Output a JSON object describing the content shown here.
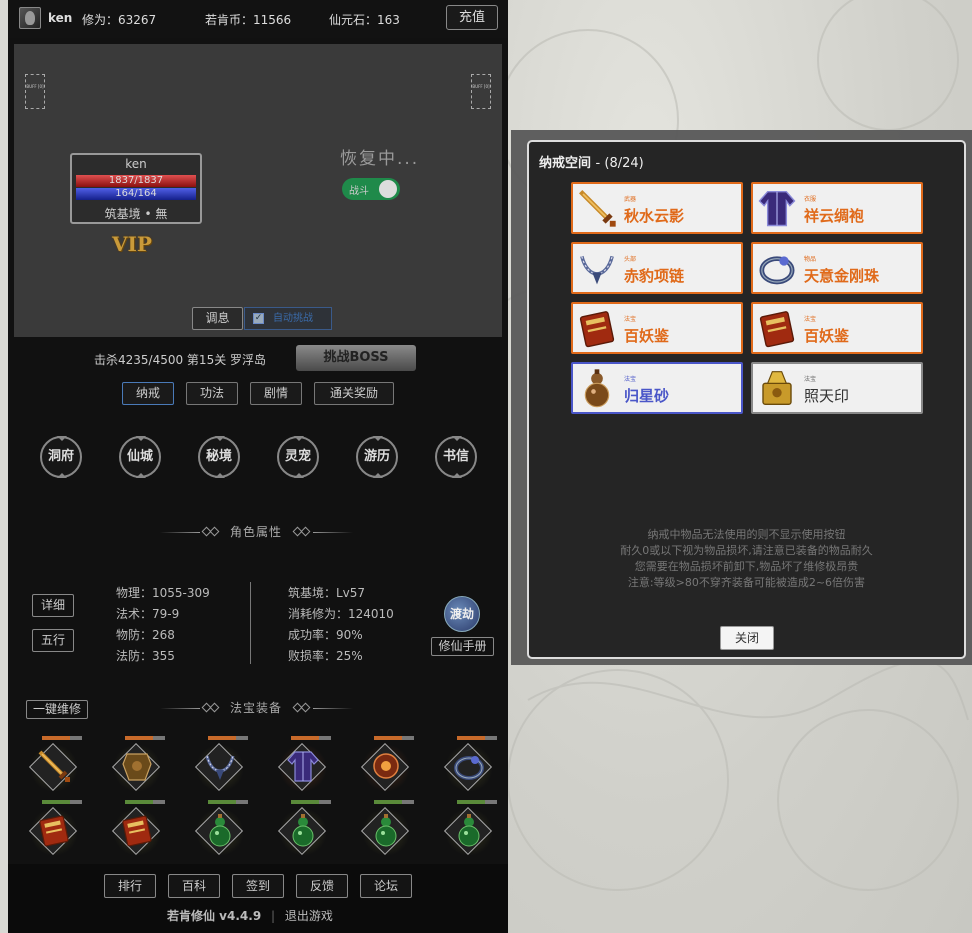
{
  "colors": {
    "accent_orange": "#e06a1a",
    "accent_blue": "#4a56c8",
    "toggle_green": "#1f8a4a",
    "hp_red": "#c03030",
    "mp_blue": "#3040c0",
    "vip_gold": "#c99a3a"
  },
  "topbar": {
    "username": "ken",
    "cultivation": "修为：63267",
    "coins": "若肯币：11566",
    "stones": "仙元石：163",
    "recharge_label": "充值"
  },
  "battle": {
    "buff_left": "BUFF [0]",
    "buff_right": "BUFF [0]",
    "char_name": "ken",
    "hp_text": "1837/1837",
    "mp_text": "164/164",
    "hp_fraction": 1.0,
    "mp_fraction": 1.0,
    "realm": "筑基境 • 無",
    "vip": "VIP",
    "status": "恢复中...",
    "battle_toggle_label": "战斗",
    "battle_toggle_on": true,
    "rest_label": "调息",
    "auto_label": "自动挑战",
    "auto_checked": true
  },
  "stage": {
    "info": "击杀4235/4500 第15关 罗浮岛",
    "boss_label": "挑战BOSS"
  },
  "tabs": [
    "纳戒",
    "功法",
    "剧情",
    "通关奖励"
  ],
  "active_tab": "纳戒",
  "places": [
    "洞府",
    "仙城",
    "秘境",
    "灵宠",
    "游历",
    "书信"
  ],
  "attributes": {
    "title": "角色属性",
    "detail_label": "详细",
    "elements_label": "五行",
    "left": [
      "物理：1055-309",
      "法术：79-9",
      "物防：268",
      "法防：355"
    ],
    "right": [
      "筑基境：Lv57",
      "消耗修为：124010",
      "成功率：90%",
      "败损率：25%"
    ],
    "dujie_label": "渡劫",
    "manual_label": "修仙手册"
  },
  "equipment": {
    "title": "法宝装备",
    "repair_label": "一键维修",
    "row1": [
      {
        "icon": "sword-icon",
        "durability": 0.7,
        "glow": "#3a3a20"
      },
      {
        "icon": "armor-icon",
        "durability": 0.7,
        "glow": "#3a3a20"
      },
      {
        "icon": "necklace-icon",
        "durability": 0.7,
        "glow": "#3a3a20"
      },
      {
        "icon": "robe-icon",
        "durability": 0.7,
        "glow": "#4a2a18"
      },
      {
        "icon": "amulet-icon",
        "durability": 0.7,
        "glow": "#4a2a18"
      },
      {
        "icon": "ring-icon",
        "durability": 0.7,
        "glow": "#3a3a20"
      }
    ],
    "row2": [
      {
        "icon": "book-icon",
        "durability": 0.7,
        "glow": "#3a3a20"
      },
      {
        "icon": "book-icon",
        "durability": 0.7,
        "glow": "#3a3a20"
      },
      {
        "icon": "gourd-icon",
        "durability": 0.7,
        "glow": "#3a3a20"
      },
      {
        "icon": "gourd-icon",
        "durability": 0.7,
        "glow": "#3a3a20"
      },
      {
        "icon": "gourd-icon",
        "durability": 0.7,
        "glow": "#3a3a20"
      },
      {
        "icon": "gourd-icon",
        "durability": 0.7,
        "glow": "#3a3a20"
      }
    ]
  },
  "footer": {
    "buttons": [
      "排行",
      "百科",
      "签到",
      "反馈",
      "论坛"
    ],
    "version": "若肯修仙 v4.4.9",
    "logout": "退出游戏"
  },
  "dialog": {
    "title": "纳戒空间",
    "count": "- (8/24)",
    "items": [
      {
        "category": "武器",
        "name": "秋水云影",
        "icon": "sword-icon",
        "quality": "orange"
      },
      {
        "category": "衣服",
        "name": "祥云绸袍",
        "icon": "robe-icon",
        "quality": "orange"
      },
      {
        "category": "头部",
        "name": "赤豹项链",
        "icon": "necklace-icon",
        "quality": "orange"
      },
      {
        "category": "物品",
        "name": "天意金刚珠",
        "icon": "ring-icon",
        "quality": "orange"
      },
      {
        "category": "法宝",
        "name": "百妖鉴",
        "icon": "book-icon",
        "quality": "orange"
      },
      {
        "category": "法宝",
        "name": "百妖鉴",
        "icon": "book-icon",
        "quality": "orange"
      },
      {
        "category": "法宝",
        "name": "归星砂",
        "icon": "gourd-icon",
        "quality": "blue"
      },
      {
        "category": "法宝",
        "name": "照天印",
        "icon": "seal-icon",
        "quality": "gray"
      }
    ],
    "notes": [
      "纳戒中物品无法使用的则不显示使用按钮",
      "耐久0或以下视为物品损坏,请注意已装备的物品耐久",
      "您需要在物品损坏前卸下,物品坏了维修极昂贵",
      "注意:等级>80不穿齐装备可能被造成2~6倍伤害"
    ],
    "close_label": "关闭"
  }
}
